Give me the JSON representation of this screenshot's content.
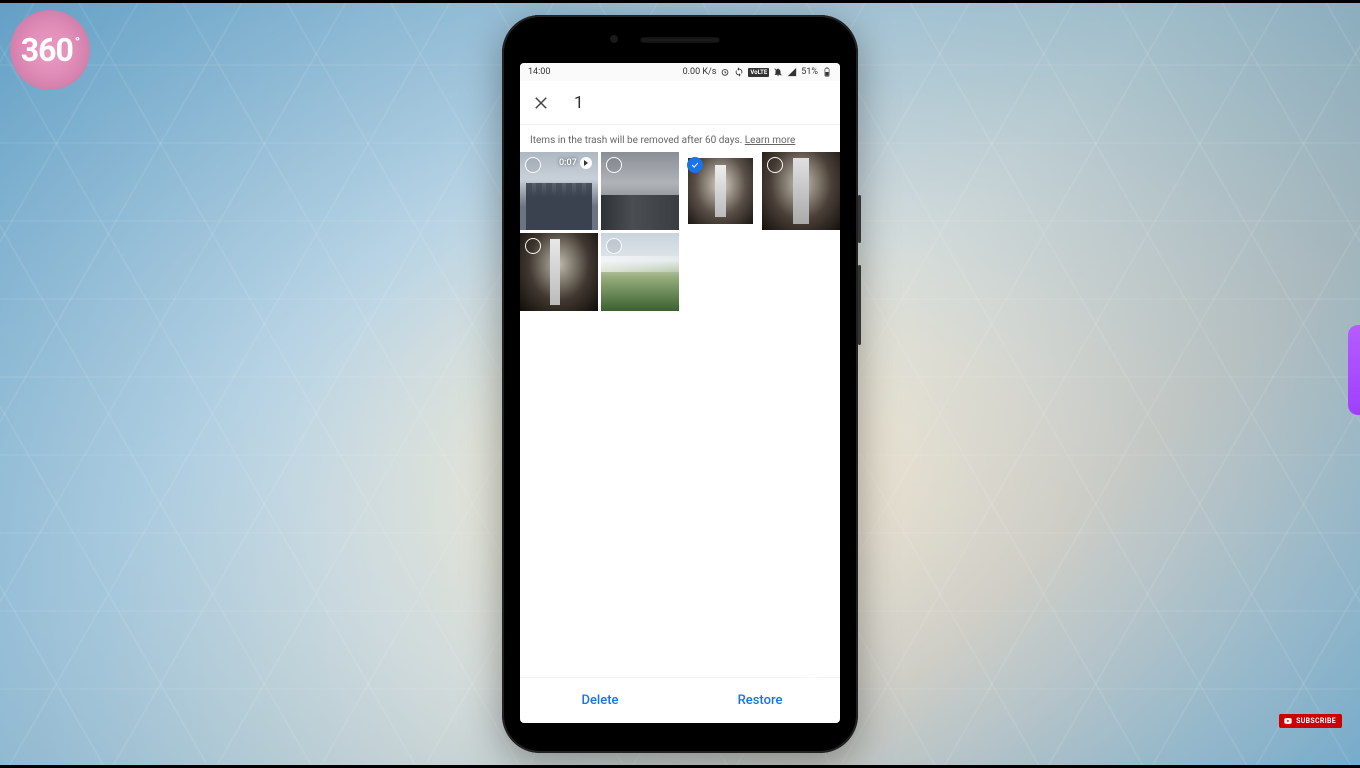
{
  "logo": {
    "text": "360",
    "degree": "°"
  },
  "subscribe_label": "SUBSCRIBE",
  "statusbar": {
    "time": "14:00",
    "net_speed": "0.00 K/s",
    "volte": "VoLTE",
    "battery_pct": "51%"
  },
  "header": {
    "selection_count": "1"
  },
  "banner": {
    "text": "Items in the trash will be removed after 60 days. ",
    "learn_more": "Learn more"
  },
  "thumbnails": [
    {
      "id": "t1",
      "selected": false,
      "is_video": true,
      "video_duration": "0:07"
    },
    {
      "id": "t2",
      "selected": false,
      "is_video": false
    },
    {
      "id": "t3",
      "selected": true,
      "is_video": false
    },
    {
      "id": "t4",
      "selected": false,
      "is_video": false
    },
    {
      "id": "t5",
      "selected": false,
      "is_video": false
    },
    {
      "id": "t6",
      "selected": false,
      "is_video": false
    }
  ],
  "actions": {
    "delete": "Delete",
    "restore": "Restore"
  }
}
